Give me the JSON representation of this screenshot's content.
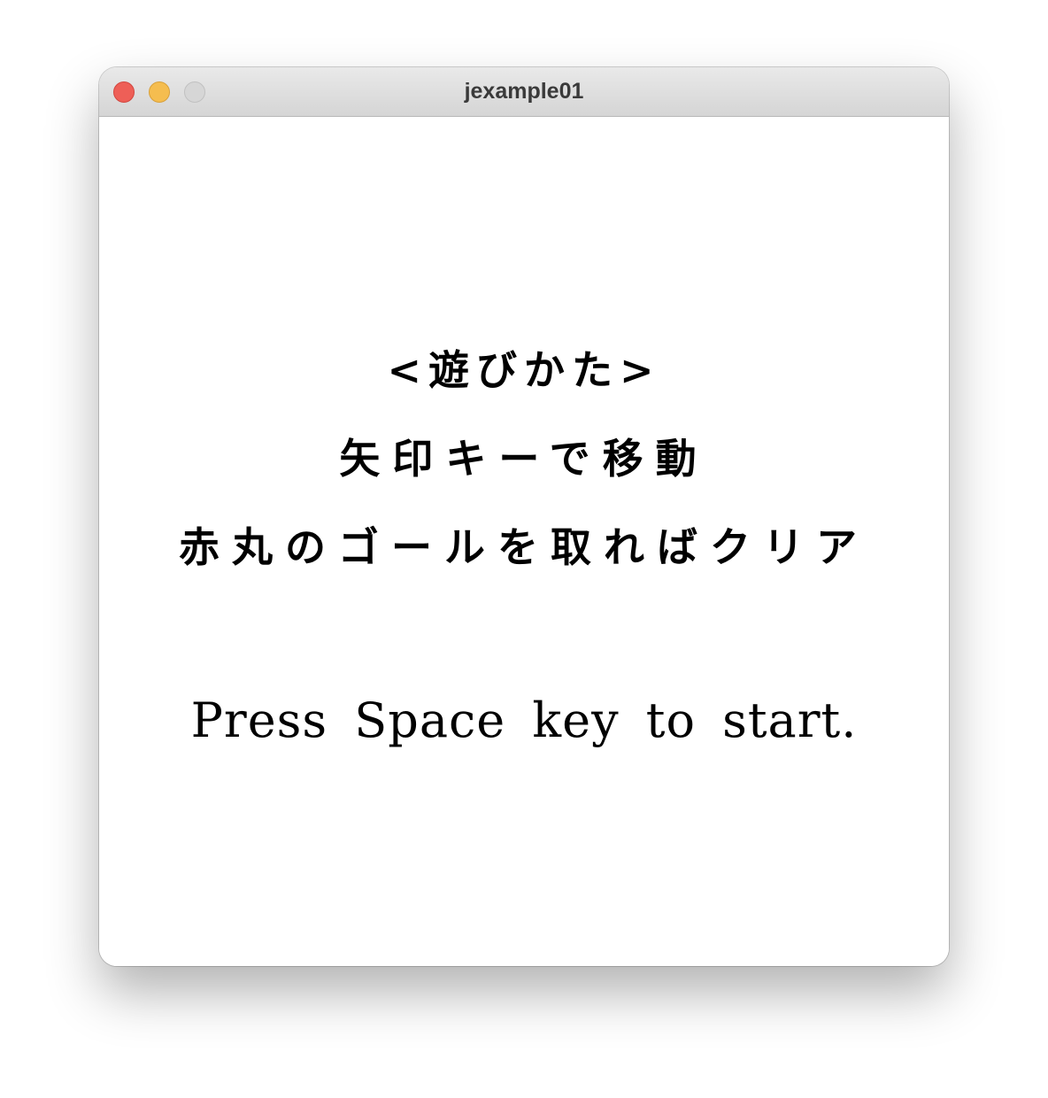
{
  "window": {
    "title": "jexample01"
  },
  "titlebar": {
    "buttons": [
      {
        "name": "close",
        "color": "#ee5f57"
      },
      {
        "name": "minimize",
        "color": "#f5bd4f"
      },
      {
        "name": "zoom",
        "color": "#d6d6d6"
      }
    ]
  },
  "instructions": {
    "heading": "<遊びかた>",
    "line1": "矢印キーで移動",
    "line2": "赤丸のゴールを取ればクリア"
  },
  "prompt": {
    "start": "Press Space key to start."
  }
}
